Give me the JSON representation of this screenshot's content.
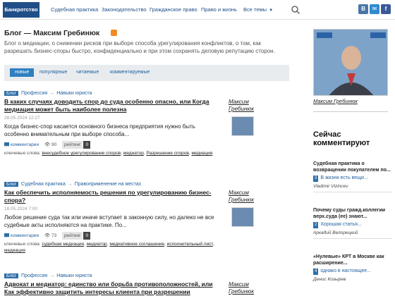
{
  "nav": {
    "brand": "Банкротство",
    "items": [
      "Судебная практика",
      "Законодательство",
      "Гражданское право",
      "Право и жизнь",
      "Все темы"
    ],
    "social": [
      "В",
      "✉",
      "f"
    ],
    "colors": {
      "brand": "#1f4f86",
      "accent": "#2f7fbf"
    }
  },
  "blog": {
    "title": "Блог — Максим Гребинюк",
    "description": "Блог о медиации, о снижении рисков при выборе способа урегулирования конфликтов, о том, как разрешать бизнес-споры быстро, конфиденциально и при этом сохранять деловую репутацию сторон."
  },
  "tabs": [
    "новые",
    "популярные",
    "читаемые",
    "комментируемые"
  ],
  "posts": [
    {
      "tag": "Блог",
      "crumbs": [
        "Профессия",
        "Навыки юриста"
      ],
      "title": "В каких случаях доводить спор до суда особенно опасно, или Когда медиация может быть наиболее полезна",
      "date": "28.05.2024 12:27",
      "excerpt": "Когда бизнес-спор касается основного бизнеса предприятия нужно быть особенно внимательным при выборе способа...",
      "comments_label": "комментарии",
      "views": "90",
      "rating_label": "рейтинг",
      "rating": "0",
      "keywords_label": "ключевые слова:",
      "keywords": [
        "внесудебное урегулирование споров",
        "медиатор",
        "Разрешение споров",
        "медиация"
      ],
      "author": "Максим Гребинюк"
    },
    {
      "tag": "Блог",
      "crumbs": [
        "Судебная практика",
        "Правоприменение на местах"
      ],
      "title": "Как обеспечить исполняемость решения по урегулированию бизнес-спора?",
      "date": "18.05.2024 7:00",
      "excerpt": "Любое решение суда так или иначе вступает в законную силу, но далеко не все судебные акты исполняются на практике. По...",
      "comments_label": "комментарии",
      "views": "73",
      "rating_label": "рейтинг",
      "rating": "0",
      "keywords_label": "ключевые слова:",
      "keywords": [
        "судебная медиация",
        "медиатор",
        "медиативное соглашение",
        "исполнительный лист",
        "медиация"
      ],
      "author": "Максим Гребинюк"
    },
    {
      "tag": "Блог",
      "crumbs": [
        "Профессия",
        "Навыки юриста"
      ],
      "title": "Адвокат и медиатор: единство или борьба противоположностей, или Как эффективно защитить интересы клиента при разрешении",
      "author": "Максим Гребинюк"
    }
  ],
  "sidebar": {
    "author": "Максим Гребинюк",
    "heading": "Сейчас комментируют",
    "items": [
      {
        "question": "Судебная практика о возвращении покупателем по...",
        "count": "3",
        "comment": "В жизни есть вещи...",
        "author": "Vladimir Vizincev"
      },
      {
        "question": "Почему суды гражд.коллегии верх.суда (ее) знают...",
        "count": "2",
        "comment": "Хорошая статья...",
        "author": "Аркадий Велорецкий"
      },
      {
        "question": "«Нулевые» КРТ в Москве как расширение...",
        "count": "4",
        "comment": "однако в настоящее...",
        "author": "Денис Козырев"
      }
    ]
  }
}
